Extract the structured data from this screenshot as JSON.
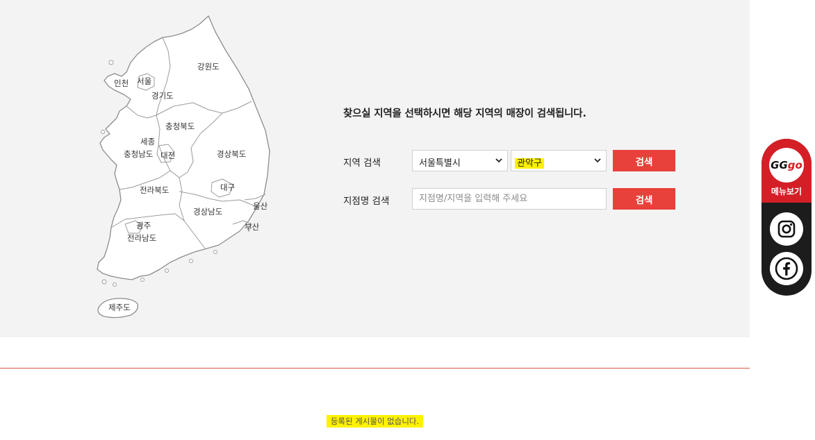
{
  "map": {
    "regions": {
      "gangwon": "강원도",
      "incheon": "인천",
      "seoul": "서울",
      "gyeonggi": "경기도",
      "chungbuk": "충청북도",
      "sejong": "세종",
      "chungnam": "충청남도",
      "daejeon": "대전",
      "gyeongbuk": "경상북도",
      "jeonbuk": "전라북도",
      "daegu": "대구",
      "ulsan": "울산",
      "gyeongnam": "경상남도",
      "busan": "부산",
      "gwangju": "광주",
      "jeonnam": "전라남도",
      "jeju": "제주도"
    }
  },
  "search": {
    "instruction": "찾으실 지역을 선택하시면 해당 지역의 매장이 검색됩니다.",
    "region_label": "지역 검색",
    "city_selected": "서울특별시",
    "district_selected": "관악구",
    "region_button": "검색",
    "branch_label": "지점명 검색",
    "branch_placeholder": "지점명/지역을 입력해 주세요",
    "branch_button": "검색"
  },
  "results": {
    "empty_message": "등록된 게시물이 없습니다."
  },
  "sidebar": {
    "logo_text_main": "GG",
    "logo_text_accent": "go",
    "menu_label": "메뉴보기",
    "instagram_icon": "instagram-icon",
    "facebook_icon": "facebook-icon"
  },
  "colors": {
    "accent_red": "#e8403a",
    "panel_bg": "#f3f3f3",
    "highlight": "#fff200",
    "sidebar_dark": "#1c1c1c"
  }
}
